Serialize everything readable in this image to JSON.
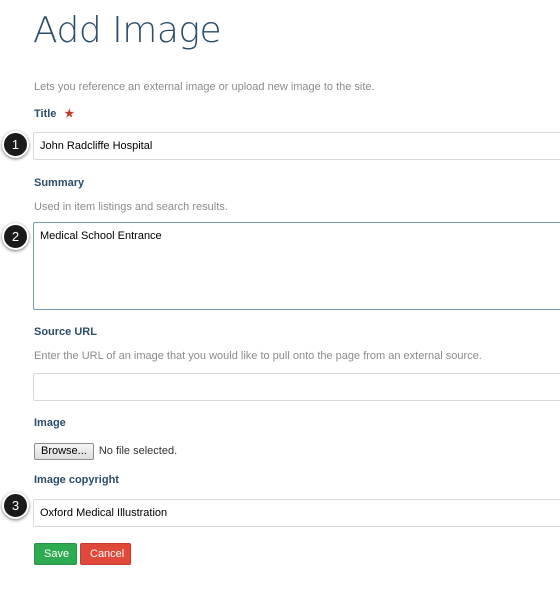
{
  "page": {
    "title": "Add Image",
    "intro": "Lets you reference an external image or upload new image to the site."
  },
  "form": {
    "title": {
      "label": "Title",
      "required_mark": "★",
      "value": "John Radcliffe Hospital"
    },
    "summary": {
      "label": "Summary",
      "help": "Used in item listings and search results.",
      "value": "Medical School Entrance"
    },
    "source_url": {
      "label": "Source URL",
      "help": "Enter the URL of an image that you would like to pull onto the page from an external source.",
      "value": ""
    },
    "image": {
      "label": "Image",
      "browse_label": "Browse...",
      "file_status": "No file selected."
    },
    "copyright": {
      "label": "Image copyright",
      "value": "Oxford Medical Illustration"
    }
  },
  "actions": {
    "save_label": "Save",
    "cancel_label": "Cancel"
  },
  "callouts": [
    "1",
    "2",
    "3"
  ],
  "colors": {
    "heading": "#2a4d6b",
    "save": "#2eaa53",
    "cancel": "#e0493a",
    "required": "#c0392b"
  }
}
